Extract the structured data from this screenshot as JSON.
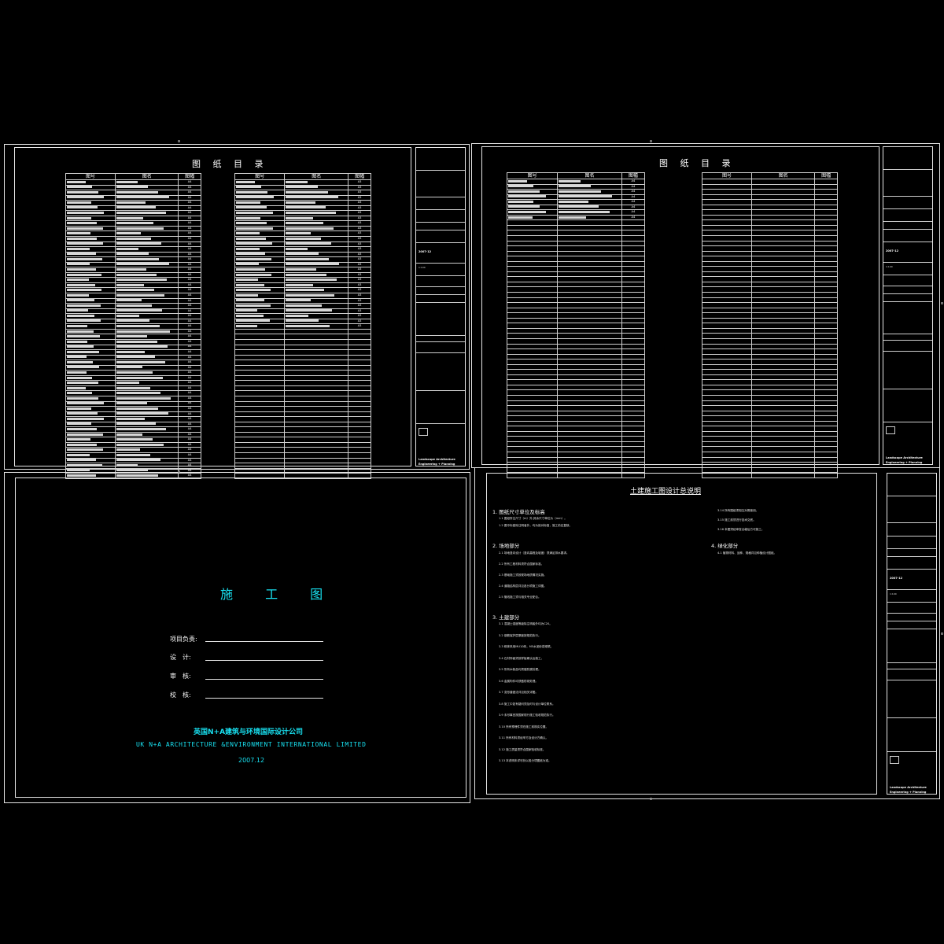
{
  "sheet1": {
    "heading": "图 纸 目 录",
    "head": [
      "图号",
      "图名",
      "图幅"
    ],
    "left_rows": 58,
    "right_rows": 44,
    "left_sizes": "A4",
    "right_sizes": "A3"
  },
  "sheet2": {
    "heading": "图 纸 目 录",
    "head": [
      "图号",
      "图名",
      "图幅"
    ],
    "rows": 64,
    "filled_rows": 8,
    "sizes": "A4"
  },
  "cover": {
    "title": "施 工 图",
    "labels": [
      "项目负责:",
      "设　计:",
      "审　核:",
      "校　核:"
    ],
    "company_cn": "英国N+A建筑与环境国际设计公司",
    "company_en": "UK  N+A ARCHITECTURE &ENVIRONMENT INTERNATIONAL  LIMITED",
    "date": "2007.12"
  },
  "notes": {
    "title": "土建施工图设计总说明",
    "sections": [
      "1. 图纸尺寸单位及标高",
      "2. 场地部分",
      "3. 土建部分",
      "4. 绿化部分"
    ],
    "sec1": [
      "1.1 图纸所注尺寸（m）外,其余尺寸单位为（mm）。",
      "1.2 图中标高除注明者外，均为绝对标高，施工前应复核。"
    ],
    "sec2": [
      "2.1 场地竖向设计（竖向高程及坡度）须满足排水要求。",
      "2.2 所有工程材料须符合国家标准。",
      "2.3 基础施工须按现场地质情况实施。",
      "2.4 道路结构层详见各分项施工详图。",
      "2.5 管线施工须与相关专业配合。"
    ],
    "sec3": [
      "3.1 混凝土强度等级除注明者外均为C20。",
      "3.2 钢筋保护层厚度按规范执行。",
      "3.3 砌体采用MU10砖，M5水泥砂浆砌筑。",
      "3.4 石材饰面须按样板确认后施工。",
      "3.5 所有木制品均须做防腐处理。",
      "3.6 金属构件均须做防锈处理。",
      "3.7 变形缝做法详见相关详图。",
      "3.8 施工中如有疑问须及时与设计单位联系。",
      "3.9 未尽事宜按国家现行施工验收规范执行。",
      "3.10 所有预埋件须在施工前核实位置。",
      "3.11 所有材料须经甲方及设计方确认。",
      "3.12 施工质量须符合国家验收标准。",
      "3.13 本说明未详尽处以各分项图纸为准。"
    ],
    "right_items": [
      "3.14 所有图纸须相互对照使用。",
      "3.15 施工前须进行技术交底。",
      "3.16 本图须经审查合格后方可施工。"
    ],
    "sec4": [
      "4.1 植物材料、品种、规格详见种植设计图纸。"
    ]
  },
  "titleblock": {
    "firm_en1": "Landscape Architecture",
    "firm_en2": "Engineering + Planning",
    "dwg_no": "2007-12",
    "sheet_no_1": "A-00",
    "scale": "1:100"
  }
}
